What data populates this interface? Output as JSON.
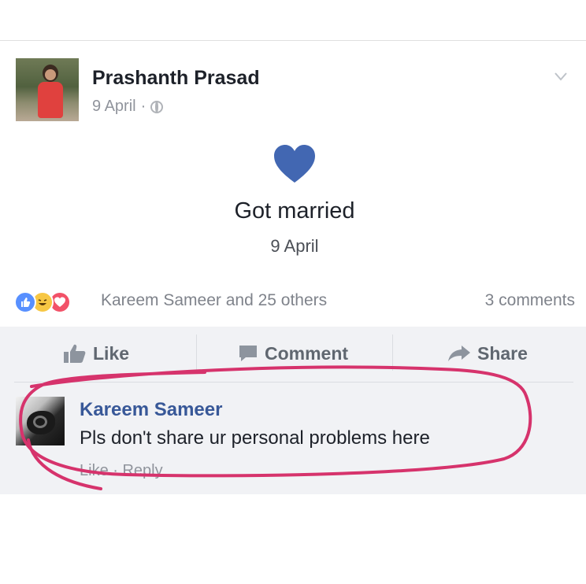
{
  "post": {
    "author": "Prashanth Prasad",
    "date": "9 April",
    "meta_separator": "·",
    "icons": {
      "audience": "globe-icon",
      "menu": "chevron-down-icon"
    },
    "life_event": {
      "icon": "heart-icon",
      "title": "Got married",
      "date": "9 April"
    }
  },
  "reactions": {
    "types": [
      "like",
      "haha",
      "love"
    ],
    "summary": "Kareem Sameer and 25 others",
    "comments_count": "3 comments"
  },
  "actions": {
    "like_label": "Like",
    "comment_label": "Comment",
    "share_label": "Share"
  },
  "comment": {
    "author": "Kareem Sameer",
    "text": "Pls don't share ur personal problems here",
    "actions_text": "Like · Reply"
  },
  "colors": {
    "heart": "#4267b2",
    "like_reaction": "#5890ff",
    "haha_reaction": "#f7c744",
    "love_reaction": "#f25268",
    "annotation": "#d6336c",
    "name_link": "#385898"
  }
}
